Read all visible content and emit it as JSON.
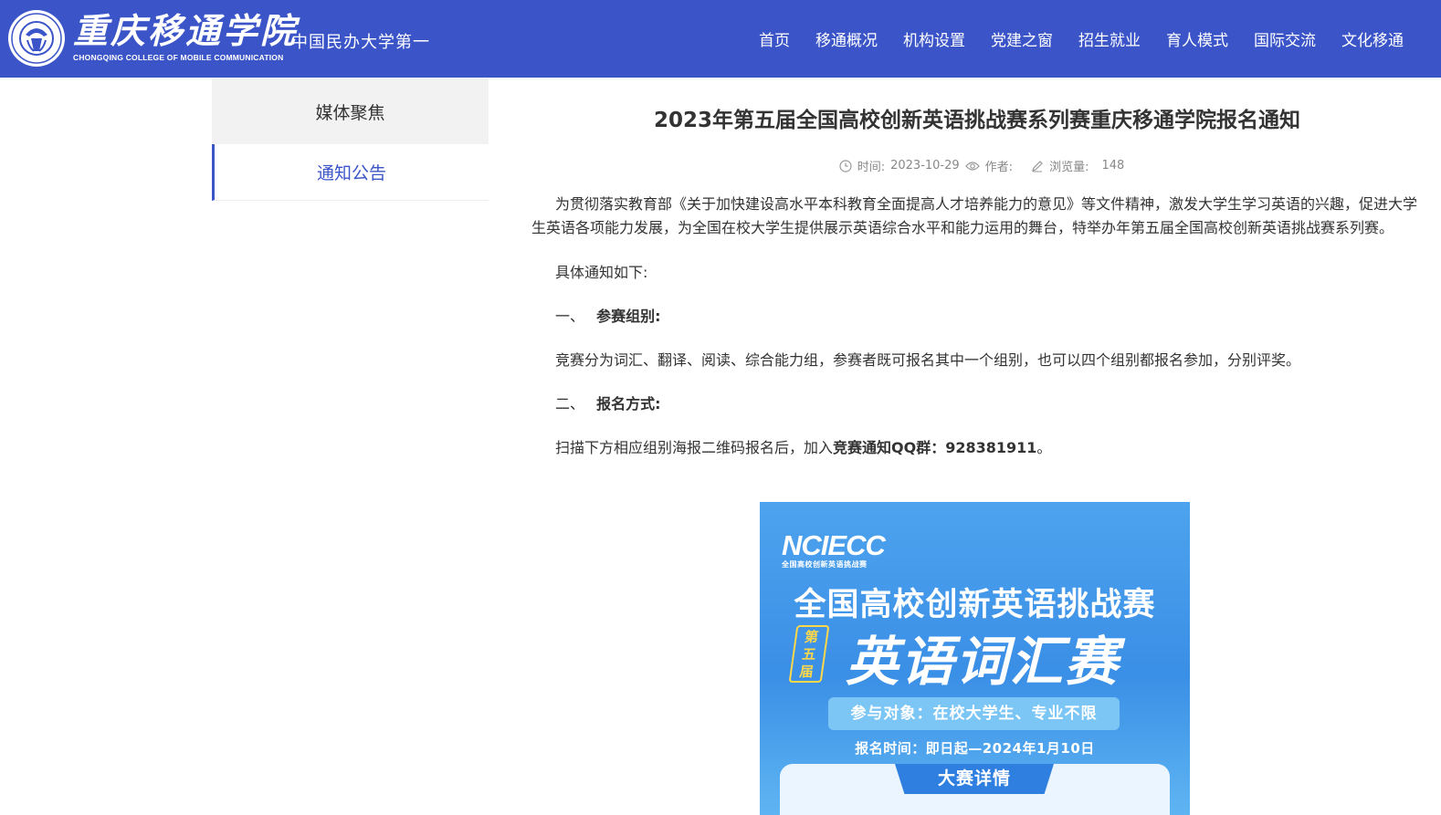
{
  "header": {
    "school_name_cn": "重庆移通学院",
    "school_name_en": "CHONGQING COLLEGE OF MOBILE COMMUNICATION",
    "slogan": "中国民办大学第一",
    "nav": [
      "首页",
      "移通概况",
      "机构设置",
      "党建之窗",
      "招生就业",
      "育人模式",
      "国际交流",
      "文化移通"
    ]
  },
  "sidebar": {
    "items": [
      {
        "label": "媒体聚焦"
      },
      {
        "label": "通知公告"
      }
    ]
  },
  "article": {
    "title": "2023年第五届全国高校创新英语挑战赛系列赛重庆移通学院报名通知",
    "meta": {
      "time_label": "时间:",
      "time_value": "2023-10-29",
      "author_label": "作者:",
      "views_label": "浏览量:",
      "views_value": "148"
    },
    "intro": "为贯彻落实教育部《关于加快建设高水平本科教育全面提高人才培养能力的意见》等文件精神，激发大学生学习英语的兴趣，促进大学生英语各项能力发展，为全国在校大学生提供展示英语综合水平和能力运用的舞台，特举办年第五届全国高校创新英语挑战赛系列赛。",
    "notice_line": "具体通知如下:",
    "section1_num": "一、",
    "section1_title": "参赛组别:",
    "section1_body": "竞赛分为词汇、翻译、阅读、综合能力组，参赛者既可报名其中一个组别，也可以四个组别都报名参加，分别评奖。",
    "section2_num": "二、",
    "section2_title": "报名方式:",
    "section2_body_prefix": "扫描下方相应组别海报二维码报名后，加入",
    "section2_body_bold": "竞赛通知QQ群：928381911",
    "section2_body_suffix": "。"
  },
  "poster": {
    "logo": "NCIECC",
    "logo_sub": "全国高校创新英语挑战赛",
    "headline": "全国高校创新英语挑战赛",
    "badge": "第五届",
    "title": "英语词汇赛",
    "audience": "参与对象：在校大学生、专业不限",
    "date": "报名时间：即日起—2024年1月10日",
    "tab": "大赛详情"
  },
  "colors": {
    "brand": "#3b55c8",
    "poster_blue": "#3a8fe6",
    "badge_yellow": "#ffd84a"
  }
}
